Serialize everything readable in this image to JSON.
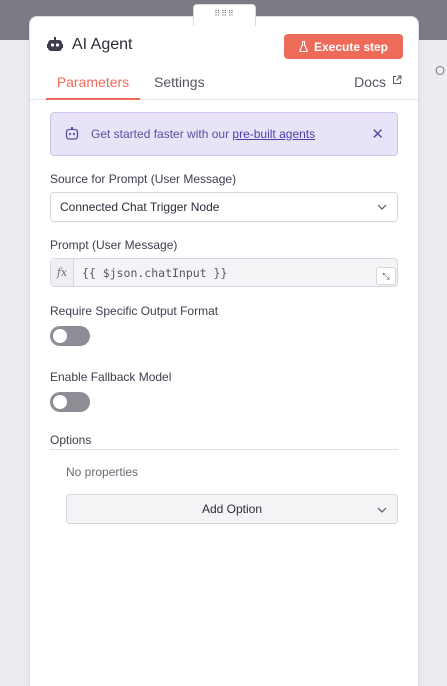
{
  "canvas": {
    "side_letter": "O"
  },
  "panel": {
    "title": "AI Agent",
    "title_icon": "robot-icon",
    "execute_button": {
      "label": "Execute step",
      "icon": "flask-icon",
      "color": "#ee6b5a"
    },
    "tabs": [
      {
        "label": "Parameters",
        "active": true
      },
      {
        "label": "Settings",
        "active": false
      }
    ],
    "docs": {
      "label": "Docs",
      "icon": "external-link-icon"
    }
  },
  "banner": {
    "text": "Get started faster with our ",
    "link": "pre-built agents",
    "icon": "robot-icon",
    "close_icon": "close-icon"
  },
  "fields": {
    "source": {
      "label": "Source for Prompt (User Message)",
      "value": "Connected Chat Trigger Node"
    },
    "prompt": {
      "label": "Prompt (User Message)",
      "fx": "fx",
      "value": "{{ $json.chatInput }}"
    },
    "output_format": {
      "label": "Require Specific Output Format",
      "enabled": false
    },
    "fallback": {
      "label": "Enable Fallback Model",
      "enabled": false
    }
  },
  "options": {
    "title": "Options",
    "empty_text": "No properties",
    "add_label": "Add Option"
  },
  "colors": {
    "accent": "#ee6b5a",
    "banner_bg": "#e8e3f7",
    "banner_text": "#5a4fa0"
  }
}
